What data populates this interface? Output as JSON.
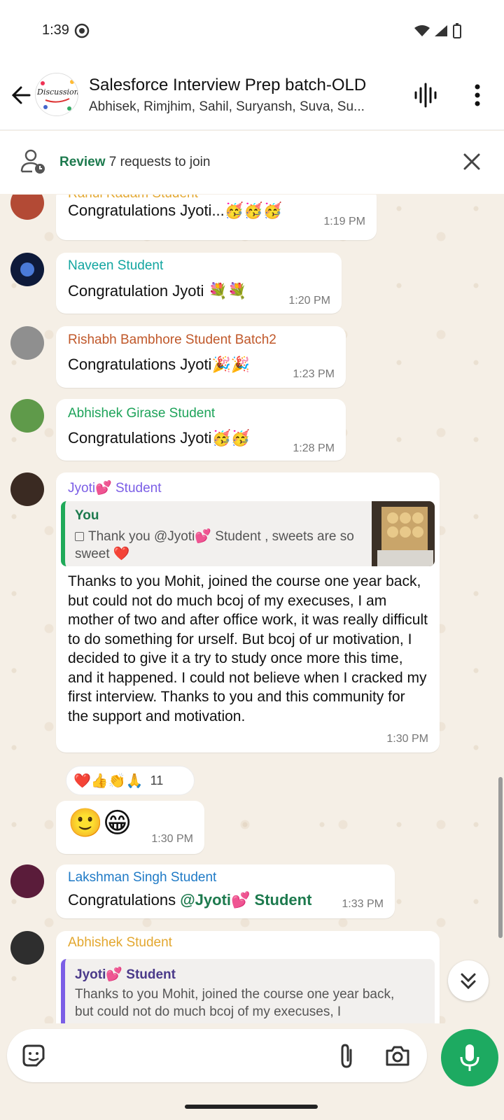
{
  "status": {
    "time": "1:39"
  },
  "header": {
    "avatar_text": "Discussion",
    "title": "Salesforce Interview Prep batch-OLD",
    "subtitle": "Abhisek, Rimjhim, Sahil, Suryansh, Suva, Su..."
  },
  "review": {
    "link": "Review",
    "text": "7 requests to join"
  },
  "messages": [
    {
      "sender": "Rahul Kadam Student",
      "text": "Congratulations Jyoti...🥳🥳🥳",
      "time": "1:19 PM",
      "sender_color": "#e3a72f"
    },
    {
      "sender": "Naveen Student",
      "text": "Congratulation Jyoti 💐💐",
      "time": "1:20 PM",
      "sender_color": "#12a5a0"
    },
    {
      "sender": "Rishabh Bambhore Student Batch2",
      "text": "Congratulations Jyoti🎉🎉",
      "time": "1:23 PM",
      "sender_color": "#c0582a"
    },
    {
      "sender": "Abhishek Girase Student",
      "text": "Congratulations Jyoti🥳🥳",
      "time": "1:28 PM",
      "sender_color": "#1ea35a"
    }
  ],
  "jyoti_msg": {
    "sender": "Jyoti💕 Student",
    "quote_author": "You",
    "quote_text": "Thank you @Jyoti💕 Student , sweets are so sweet ❤️",
    "text": "Thanks to you Mohit, joined the course one year back, but could not do much bcoj of my execuses, I am mother of two and after office work, it was really difficult to do something for urself. But bcoj of ur motivation, I decided to give it a try to study once more this time, and it happened. I could not believe when I cracked my first interview. Thanks to you and this community for the support and motivation.",
    "time": "1:30 PM",
    "reactions": "❤️👍👏🙏",
    "reaction_count": "11"
  },
  "emoji_msg": {
    "text": "🙂😁",
    "time": "1:30 PM"
  },
  "lakshman_msg": {
    "sender": "Lakshman Singh Student",
    "prefix": "Congratulations ",
    "mention": "@Jyoti💕 Student",
    "time": "1:33 PM"
  },
  "abhishek_msg": {
    "sender": "Abhishek Student",
    "quote_author": "Jyoti💕 Student",
    "quote_text": "Thanks to you Mohit, joined the course one year back, but could not do much bcoj of my execuses, I"
  },
  "composer": {
    "placeholder": ""
  },
  "colors": {
    "accent": "#1daa61",
    "review": "#1d7a4e"
  }
}
